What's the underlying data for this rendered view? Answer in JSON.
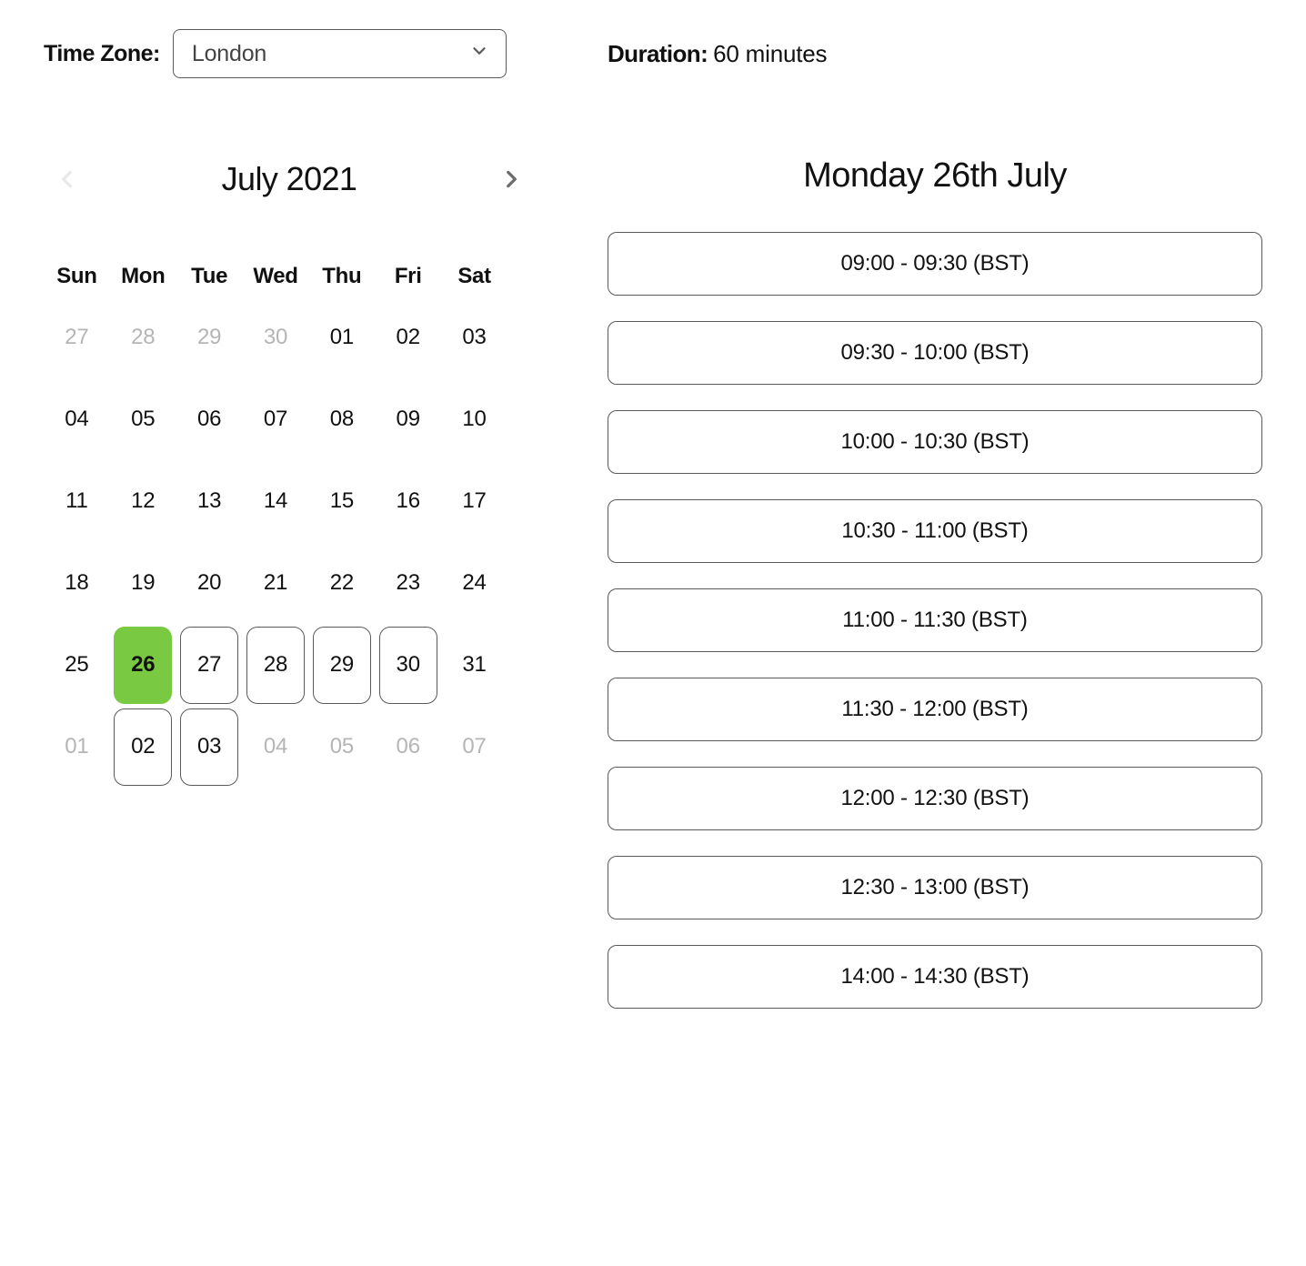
{
  "timezone": {
    "label": "Time Zone:",
    "value": "London"
  },
  "duration": {
    "label": "Duration:",
    "value": "60 minutes"
  },
  "calendar": {
    "month_label": "July 2021",
    "prev_enabled": false,
    "next_enabled": true,
    "weekdays": [
      "Sun",
      "Mon",
      "Tue",
      "Wed",
      "Thu",
      "Fri",
      "Sat"
    ],
    "days": [
      {
        "n": "27",
        "state": "outside"
      },
      {
        "n": "28",
        "state": "outside"
      },
      {
        "n": "29",
        "state": "outside"
      },
      {
        "n": "30",
        "state": "outside"
      },
      {
        "n": "01",
        "state": "regular"
      },
      {
        "n": "02",
        "state": "regular"
      },
      {
        "n": "03",
        "state": "regular"
      },
      {
        "n": "04",
        "state": "regular"
      },
      {
        "n": "05",
        "state": "regular"
      },
      {
        "n": "06",
        "state": "regular"
      },
      {
        "n": "07",
        "state": "regular"
      },
      {
        "n": "08",
        "state": "regular"
      },
      {
        "n": "09",
        "state": "regular"
      },
      {
        "n": "10",
        "state": "regular"
      },
      {
        "n": "11",
        "state": "regular"
      },
      {
        "n": "12",
        "state": "regular"
      },
      {
        "n": "13",
        "state": "regular"
      },
      {
        "n": "14",
        "state": "regular"
      },
      {
        "n": "15",
        "state": "regular"
      },
      {
        "n": "16",
        "state": "regular"
      },
      {
        "n": "17",
        "state": "regular"
      },
      {
        "n": "18",
        "state": "regular"
      },
      {
        "n": "19",
        "state": "regular"
      },
      {
        "n": "20",
        "state": "regular"
      },
      {
        "n": "21",
        "state": "regular"
      },
      {
        "n": "22",
        "state": "regular"
      },
      {
        "n": "23",
        "state": "regular"
      },
      {
        "n": "24",
        "state": "regular"
      },
      {
        "n": "25",
        "state": "regular"
      },
      {
        "n": "26",
        "state": "selected"
      },
      {
        "n": "27",
        "state": "available"
      },
      {
        "n": "28",
        "state": "available"
      },
      {
        "n": "29",
        "state": "available"
      },
      {
        "n": "30",
        "state": "available"
      },
      {
        "n": "31",
        "state": "regular"
      },
      {
        "n": "01",
        "state": "outside"
      },
      {
        "n": "02",
        "state": "available"
      },
      {
        "n": "03",
        "state": "available"
      },
      {
        "n": "04",
        "state": "outside"
      },
      {
        "n": "05",
        "state": "outside"
      },
      {
        "n": "06",
        "state": "outside"
      },
      {
        "n": "07",
        "state": "outside"
      }
    ]
  },
  "selected_date_label": "Monday 26th July",
  "slots": [
    {
      "label": "09:00 - 09:30 (BST)"
    },
    {
      "label": "09:30 - 10:00 (BST)"
    },
    {
      "label": "10:00 - 10:30 (BST)"
    },
    {
      "label": "10:30 - 11:00 (BST)"
    },
    {
      "label": "11:00 - 11:30 (BST)"
    },
    {
      "label": "11:30 - 12:00 (BST)"
    },
    {
      "label": "12:00 - 12:30 (BST)"
    },
    {
      "label": "12:30 - 13:00 (BST)"
    },
    {
      "label": "14:00 - 14:30 (BST)"
    }
  ]
}
